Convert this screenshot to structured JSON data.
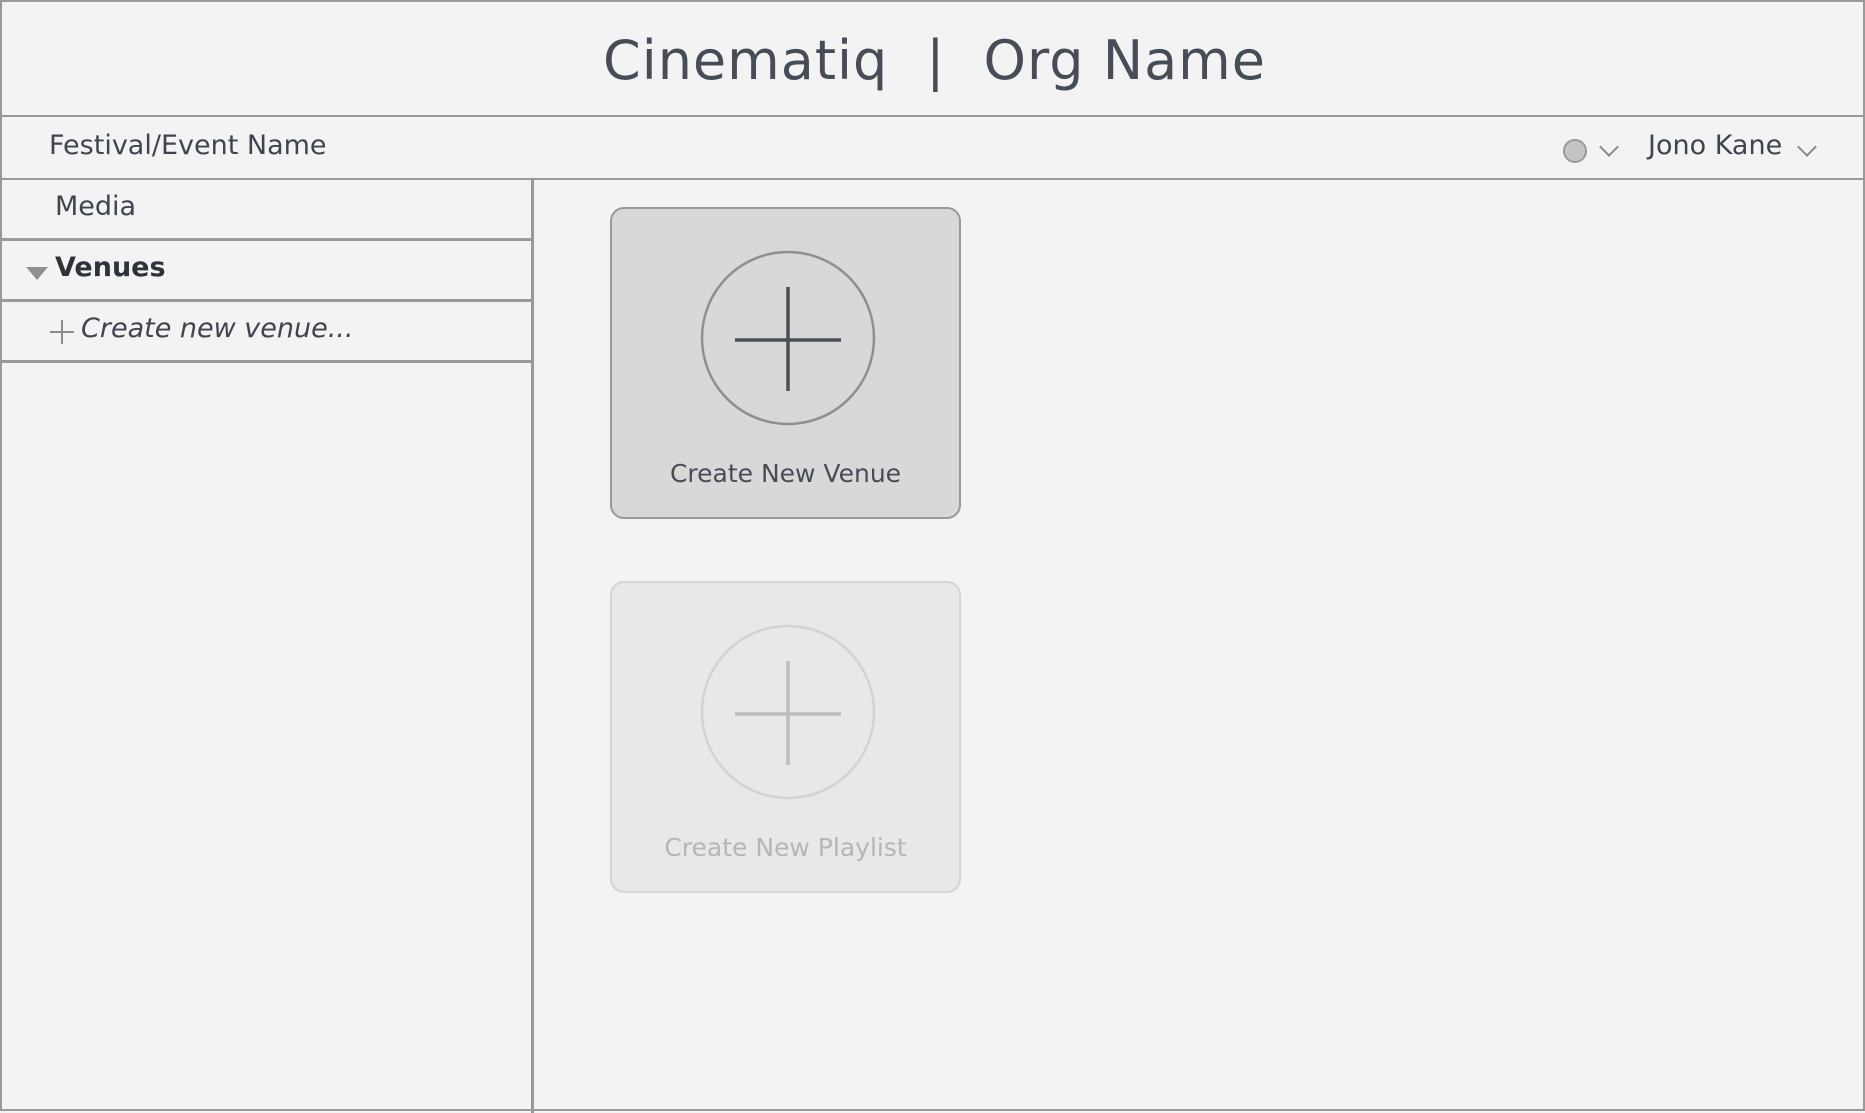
{
  "header": {
    "app_name": "Cinematiq",
    "separator": "|",
    "org_name": "Org Name"
  },
  "subheader": {
    "event_name": "Festival/Event Name",
    "status_icon": "status-dot-icon",
    "user_name": "Jono Kane"
  },
  "sidebar": {
    "items": [
      {
        "label": "Media"
      },
      {
        "label": "Venues",
        "expanded": true
      },
      {
        "label": "Create new venue..."
      }
    ]
  },
  "main": {
    "cards": [
      {
        "label": "Create New Venue",
        "enabled": true
      },
      {
        "label": "Create New Playlist",
        "enabled": false
      }
    ]
  },
  "colors": {
    "background": "#f3f3f3",
    "border": "#999999",
    "text": "#474d57",
    "card_active": "#d8d8d8",
    "card_disabled": "#e8e8e8"
  }
}
